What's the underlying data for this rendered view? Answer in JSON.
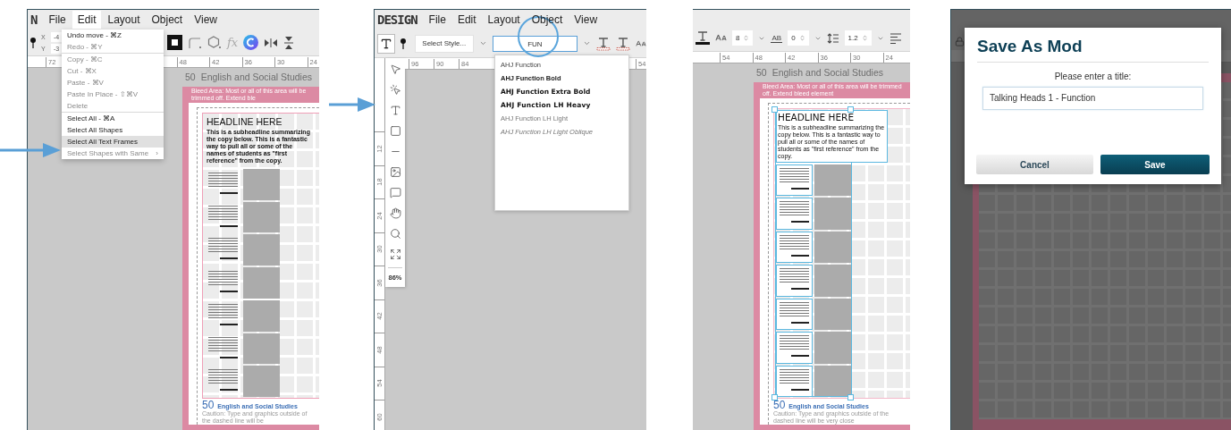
{
  "screens": [
    {
      "kind": "edit_menu",
      "logo": "N",
      "menu": [
        {
          "label": "File",
          "selected": false
        },
        {
          "label": "Edit",
          "selected": true
        },
        {
          "label": "Layout",
          "selected": false
        },
        {
          "label": "Object",
          "selected": false
        },
        {
          "label": "View",
          "selected": false
        }
      ],
      "position": [
        {
          "label": "X",
          "value": "-4"
        },
        {
          "label": "Y",
          "value": "-3"
        }
      ],
      "effects_label": "fx",
      "ruler": [
        {
          "labels": [
            "72"
          ]
        },
        {
          "labels": [
            "48",
            "42",
            "36",
            "30",
            "24"
          ]
        }
      ],
      "edit_menu": [
        {
          "items": [
            {
              "label": "Undo move - ⌘Z",
              "disabled": false,
              "highlighted": false
            },
            {
              "label": "Redo - ⌘Y",
              "disabled": true,
              "highlighted": false
            }
          ]
        },
        {
          "items": [
            {
              "label": "Copy - ⌘C",
              "disabled": true,
              "highlighted": false
            },
            {
              "label": "Cut - ⌘X",
              "disabled": true,
              "highlighted": false
            },
            {
              "label": "Paste - ⌘V",
              "disabled": true,
              "highlighted": false
            },
            {
              "label": "Paste In Place - ⇧⌘V",
              "disabled": true,
              "highlighted": false
            },
            {
              "label": "Delete",
              "disabled": true,
              "highlighted": false
            }
          ]
        },
        {
          "items": [
            {
              "label": "Select All - ⌘A",
              "disabled": false,
              "highlighted": false
            },
            {
              "label": "Select All Shapes",
              "disabled": false,
              "highlighted": false
            },
            {
              "label": "Select All Text Frames",
              "disabled": false,
              "highlighted": true
            },
            {
              "label": "Select Shapes with Same",
              "disabled": true,
              "highlighted": false,
              "submenu": "›"
            }
          ]
        }
      ],
      "page": {
        "number": "50",
        "section": "English and Social Studies",
        "bleed_note": "Bleed Area: Most or all of this area will be trimmed off. Extend ble",
        "headline": "HEADLINE HERE",
        "subheadline": "This is a subheadline summarizing the copy below. This is a fantastic way to pull all or some of the names of students as \"first reference\" from the copy.",
        "footer_number": "50",
        "footer_title": "English and Social Studies",
        "caution": "Caution: Type and graphics outside of the dashed line will be",
        "frames_selected": false
      }
    },
    {
      "kind": "font_menu",
      "logo": "DESIGN",
      "menu": [
        {
          "label": "File",
          "selected": false
        },
        {
          "label": "Edit",
          "selected": false
        },
        {
          "label": "Layout",
          "selected": false
        },
        {
          "label": "Object",
          "selected": false
        },
        {
          "label": "View",
          "selected": false
        }
      ],
      "style_select": "Select Style...",
      "font_field": "FUN",
      "ruler": [
        {
          "labels": [
            "96",
            "90",
            "84"
          ]
        },
        {
          "labels": [
            "54"
          ]
        }
      ],
      "vertical_ruler": [
        "12",
        "18",
        "24",
        "30",
        "36",
        "42",
        "48",
        "54",
        "60"
      ],
      "tools": [
        {
          "kind": "select"
        },
        {
          "kind": "direct_select"
        },
        {
          "kind": "text"
        },
        {
          "kind": "rectangle"
        },
        {
          "kind": "line"
        },
        {
          "kind": "image"
        },
        {
          "kind": "comment"
        },
        {
          "kind": "hand"
        },
        {
          "kind": "zoom"
        },
        {
          "kind": "fit"
        }
      ],
      "zoom": "86%",
      "font_options": [
        {
          "label": "AHJ Function",
          "kind": "regular"
        },
        {
          "label": "AHJ Function Bold",
          "kind": "bold"
        },
        {
          "label": "AHJ Function Extra Bold",
          "kind": "extra_bold"
        },
        {
          "label": "AHJ Function LH Heavy",
          "kind": "heavy"
        },
        {
          "label": "AHJ Function LH Light",
          "kind": "light"
        },
        {
          "label": "AHJ Function LH Light Oblique",
          "kind": "oblique"
        }
      ]
    },
    {
      "kind": "type_toolbar",
      "font_size": "8",
      "tracking_label": "AB",
      "tracking": "0",
      "leading": "1.2",
      "ruler": [
        {
          "labels": [
            "54",
            "48",
            "42",
            "36",
            "30",
            "24"
          ]
        }
      ],
      "page": {
        "number": "50",
        "section": "English and Social Studies",
        "bleed_note": "Bleed Area: Most or all of this area will be trimmed off. Extend bleed element",
        "headline": "HEADLINE HERE",
        "subheadline": "This is a subheadline summarizing the copy below. This is a fantastic way to pull all or some of the names of students as \"first reference\" from the copy.",
        "footer_number": "50",
        "footer_title": "English and Social Studies",
        "caution": "Caution: Type and graphics outside of the dashed line will be very close",
        "frames_selected": true
      }
    },
    {
      "kind": "save_dialog",
      "title": "Save As Mod",
      "prompt": "Please enter a title:",
      "value": "Talking Heads 1 - Function",
      "buttons": [
        {
          "label": "Cancel",
          "kind": "secondary"
        },
        {
          "label": "Save",
          "kind": "primary"
        }
      ]
    }
  ]
}
